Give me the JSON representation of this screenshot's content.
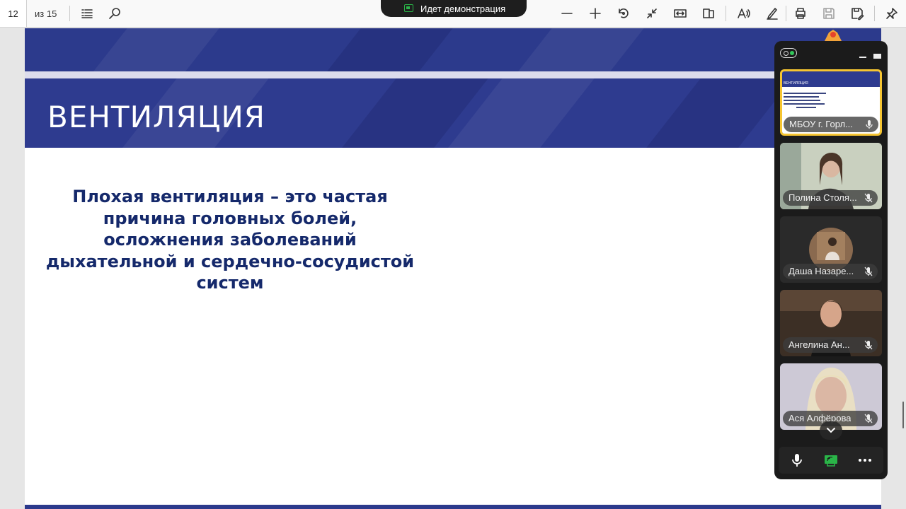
{
  "toolbar": {
    "current_page": "12",
    "page_total": "из 15",
    "buttons": [
      "contents-icon",
      "search-icon",
      "zoom-out-icon",
      "zoom-in-icon",
      "rotate-icon",
      "collapse-icon",
      "fit-width-icon",
      "two-page-icon",
      "read-aloud-icon",
      "draw-icon",
      "print-icon",
      "save-icon",
      "save-as-icon",
      "pin-icon"
    ]
  },
  "demo_banner": {
    "label": "Идет демонстрация"
  },
  "slide": {
    "title": "ВЕНТИЛЯЦИЯ",
    "body_lines": [
      "Плохая вентиляция – это частая",
      "причина головных болей,",
      "осложнения заболеваний",
      "дыхательной и сердечно-сосудистой",
      "систем"
    ],
    "colors": {
      "band": "#2e3b8f",
      "text": "#15296b"
    }
  },
  "call": {
    "participants": [
      {
        "name": "МБОУ г. Горл...",
        "mic": "on",
        "kind": "screen"
      },
      {
        "name": "Полина Столя...",
        "mic": "muted",
        "kind": "video"
      },
      {
        "name": "Даша Назаре...",
        "mic": "muted",
        "kind": "avatar"
      },
      {
        "name": "Ангелина Ан...",
        "mic": "muted",
        "kind": "video"
      },
      {
        "name": "Ася Алфёрова",
        "mic": "muted",
        "kind": "video"
      }
    ],
    "thumb_title": "ВЕНТИЛЯЦИЯ",
    "controls": [
      "microphone-icon",
      "screen-share-icon",
      "more-icon"
    ],
    "accent": "#f6c531"
  }
}
